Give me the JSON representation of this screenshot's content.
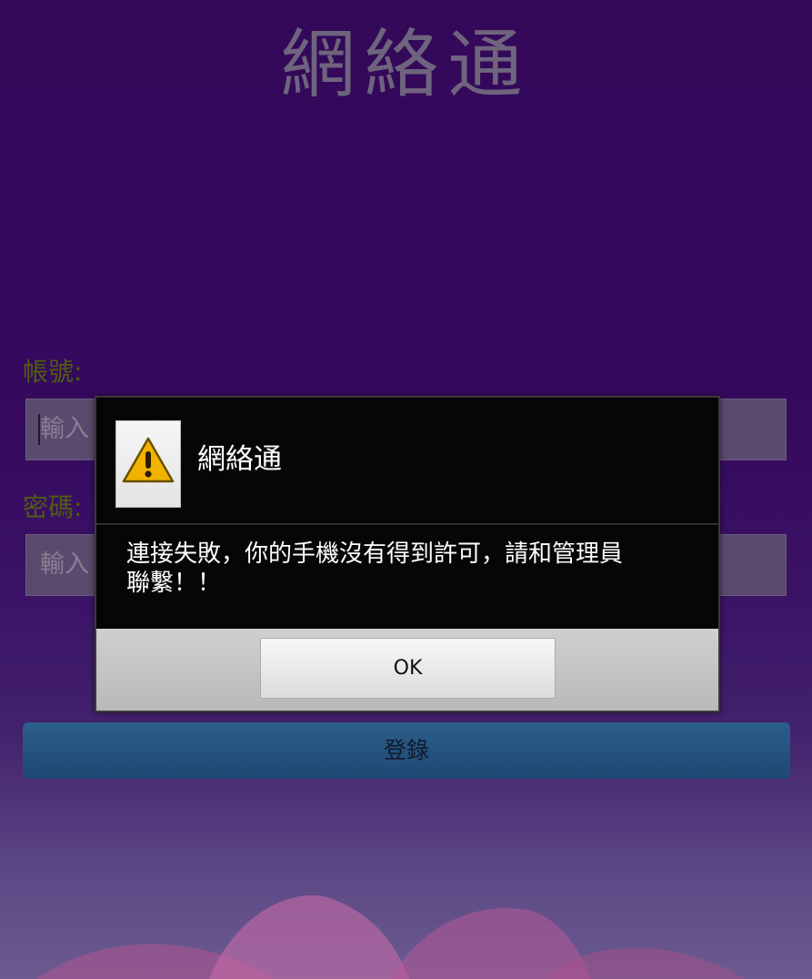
{
  "app": {
    "title": "網絡通"
  },
  "form": {
    "account_label": "帳號:",
    "account_placeholder": "輸入",
    "password_label": "密碼:",
    "password_placeholder": "輸入",
    "login_label": "登錄"
  },
  "dialog": {
    "icon": "warning-icon",
    "title": "網絡通",
    "message_line1": "連接失敗，你的手機沒有得到許可，請和管理員",
    "message_line2": "聯繫！！",
    "ok_label": "OK"
  },
  "colors": {
    "background": "#34095a",
    "dialog_bg": "#080508",
    "warning": "#f2b300",
    "login_button": "#2b5f8a"
  }
}
